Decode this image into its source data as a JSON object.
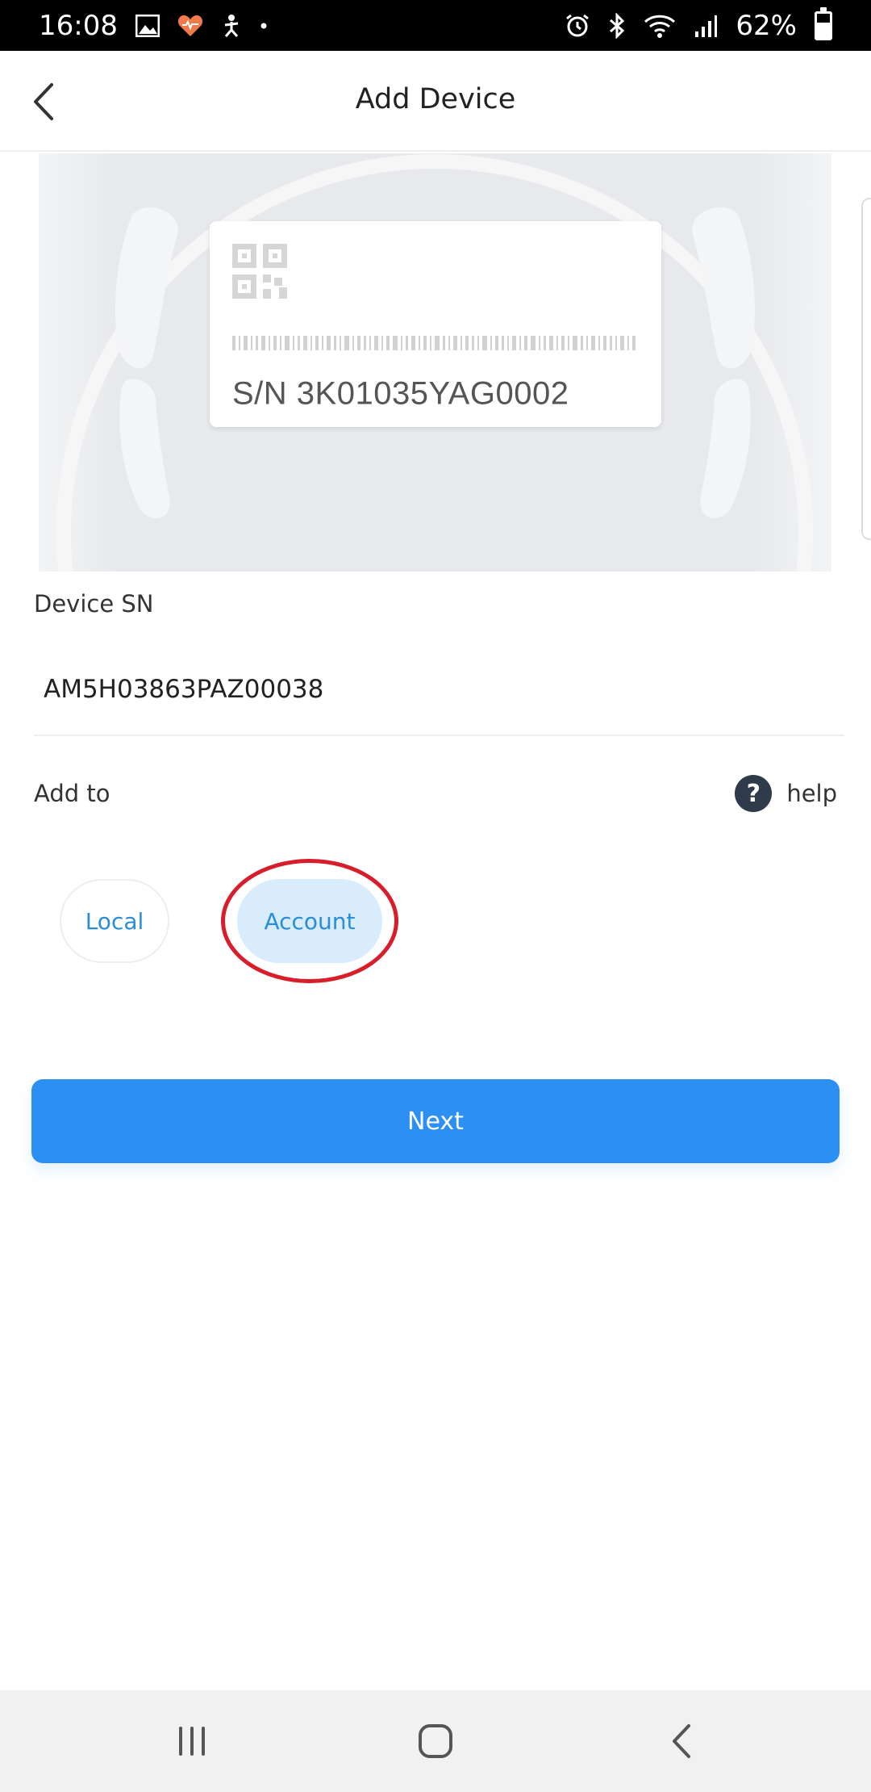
{
  "status_bar": {
    "time": "16:08",
    "left_icons": [
      "image-icon",
      "heart-icon",
      "figure-icon",
      "dot-icon"
    ],
    "right_icons": [
      "alarm-icon",
      "bluetooth-icon",
      "wifi-icon",
      "signal-icon"
    ],
    "battery_text": "62%",
    "battery_level": 0.62
  },
  "header": {
    "title": "Add Device",
    "back_icon": "chevron-left-icon"
  },
  "hero": {
    "sn_label_text": "S/N  3K01035YAG0002"
  },
  "form": {
    "sn_label": "Device SN",
    "sn_value": "AM5H03863PAZ00038",
    "add_to_label": "Add to",
    "help_icon": "question-icon",
    "help_text": "help",
    "options": [
      {
        "label": "Local",
        "selected": false
      },
      {
        "label": "Account",
        "selected": true
      }
    ],
    "next_label": "Next"
  },
  "colors": {
    "accent": "#2c8ff2",
    "option_text": "#2a8dd8",
    "selected_option_bg": "#d9ecfb",
    "annotation_red": "#d81e2a"
  },
  "nav_bar": {
    "buttons": [
      "recent-apps-icon",
      "home-icon",
      "back-icon"
    ]
  }
}
